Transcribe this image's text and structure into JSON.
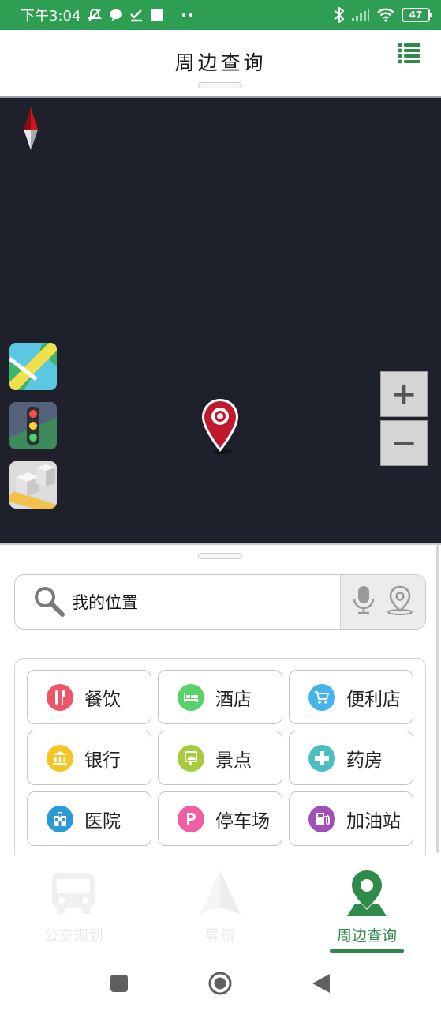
{
  "status_bar": {
    "time": "下午3:04",
    "battery": "47",
    "icons": [
      "mute-icon",
      "chat-bubble-icon",
      "check-icon",
      "square-icon",
      "more-dots-icon",
      "bluetooth-icon",
      "signal-icon",
      "wifi-icon",
      "battery-icon"
    ]
  },
  "header": {
    "title": "周边查询",
    "menu_icon": "list-menu-icon"
  },
  "map": {
    "layer_buttons": [
      "map-layer-icon",
      "traffic-layer-icon",
      "3d-building-layer-icon"
    ],
    "zoom_in_label": "+",
    "zoom_out_label": "−"
  },
  "search": {
    "value": "我的位置",
    "icons": [
      "search-icon",
      "microphone-icon",
      "location-pin-icon"
    ]
  },
  "categories": [
    {
      "label": "餐饮",
      "icon": "fork-knife-icon",
      "color": "#ef5468"
    },
    {
      "label": "酒店",
      "icon": "bed-icon",
      "color": "#5bd16c"
    },
    {
      "label": "便利店",
      "icon": "cart-icon",
      "color": "#45b4ea"
    },
    {
      "label": "银行",
      "icon": "bank-icon",
      "color": "#f7c425"
    },
    {
      "label": "景点",
      "icon": "scenic-icon",
      "color": "#a6cc3e"
    },
    {
      "label": "药房",
      "icon": "medical-cross-icon",
      "color": "#4dbdc0"
    },
    {
      "label": "医院",
      "icon": "hospital-icon",
      "color": "#2d9ad8"
    },
    {
      "label": "停车场",
      "icon": "parking-icon",
      "color": "#ef5fa2"
    },
    {
      "label": "加油站",
      "icon": "fuel-pump-icon",
      "color": "#9f4fb5"
    }
  ],
  "bottom_nav": [
    {
      "label": "公交规划",
      "icon": "bus-icon",
      "active": false
    },
    {
      "label": "导航",
      "icon": "paper-plane-icon",
      "active": false
    },
    {
      "label": "周边查询",
      "icon": "map-pin-icon",
      "active": true
    }
  ],
  "colors": {
    "brand_green": "#2e9e52",
    "active_green": "#2e8b4a",
    "map_bg": "#1e212b",
    "pin_red": "#c0192c"
  }
}
